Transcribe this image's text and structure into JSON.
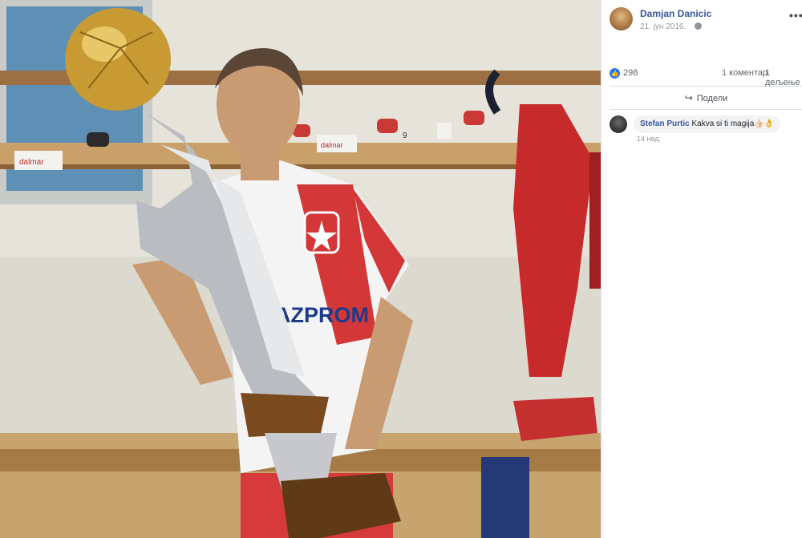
{
  "post": {
    "author": "Damjan Danicic",
    "date": "21. јун 2016.",
    "more_icon": "ellipsis-icon",
    "privacy_icon": "globe-icon"
  },
  "reactions": {
    "like_icon": "thumbs-up-icon",
    "like_count": "298",
    "comments": "1 коментар",
    "shares": "1 дељење"
  },
  "actions": {
    "share_label": "Подели",
    "share_icon": "share-arrow-icon"
  },
  "comments": [
    {
      "author": "Stefan Purtic",
      "text": "Kakva si ti magija👍🏻👌",
      "time": "14 нед."
    }
  ],
  "photo": {
    "shirt_sponsor": "GAZPROM",
    "sign_left": "dalmar",
    "sign_right": "dalmar",
    "hook_number": "9"
  }
}
